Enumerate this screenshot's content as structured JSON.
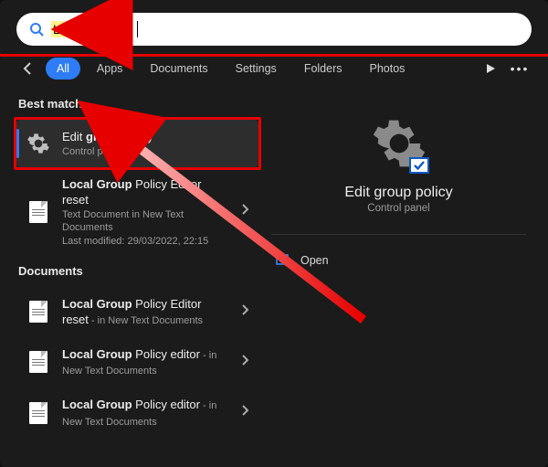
{
  "search": {
    "query": "Local Group "
  },
  "tabs": [
    "All",
    "Apps",
    "Documents",
    "Settings",
    "Folders",
    "Photos"
  ],
  "tabs_active_index": 0,
  "sections": {
    "best_match_label": "Best match",
    "documents_label": "Documents"
  },
  "results": {
    "best": {
      "title_pre": "Edit ",
      "title_bold": "group",
      "title_post": " policy",
      "subtitle": "Control panel"
    },
    "r1": {
      "title_bold": "Local Group",
      "title_post": " Policy Editor reset",
      "sub1": "Text Document in New Text Documents",
      "sub2": "Last modified: 29/03/2022, 22:15"
    },
    "d1": {
      "title_bold": "Local Group",
      "title_post": " Policy Editor reset",
      "tail": " - in New Text Documents"
    },
    "d2": {
      "title_bold": "Local Group",
      "title_post": " Policy editor",
      "tail": " - in New Text Documents"
    },
    "d3": {
      "title_bold": "Local Group",
      "title_post": " Policy editor",
      "tail": " - in New Text Documents"
    }
  },
  "preview": {
    "title": "Edit group policy",
    "subtitle": "Control panel",
    "open_label": "Open"
  },
  "colors": {
    "accent": "#2e7cf6",
    "annotation": "#e60000"
  }
}
